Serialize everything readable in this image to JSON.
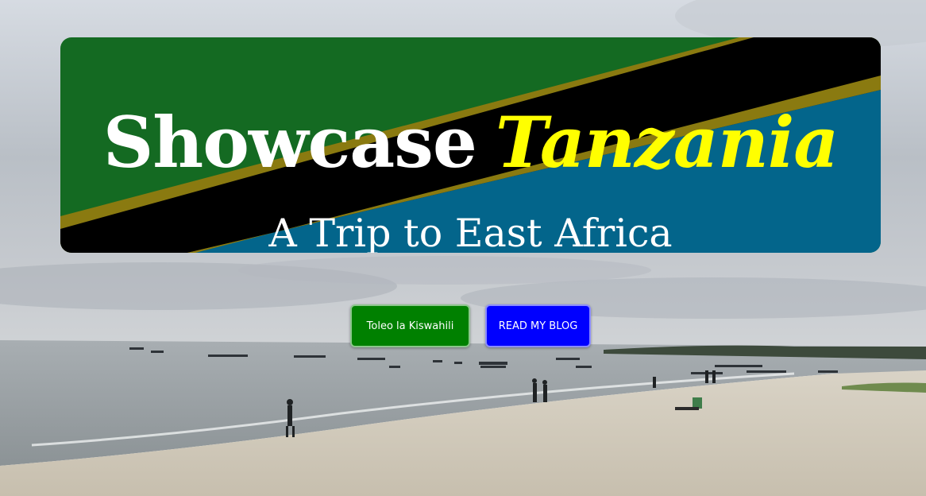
{
  "banner": {
    "title_part1": "Showcase",
    "title_part2": "Tanzania",
    "subtitle": "A Trip to East Africa"
  },
  "buttons": {
    "kiswahili_label": "Toleo la Kiswahili",
    "blog_label": "READ MY BLOG"
  },
  "colors": {
    "flag_green": "#146a22",
    "flag_yellow": "#8a7a10",
    "flag_black": "#000000",
    "flag_blue": "#03658b",
    "title_accent": "#ffff00",
    "kiswahili_button": "#008000",
    "blog_button": "#0000ff"
  }
}
